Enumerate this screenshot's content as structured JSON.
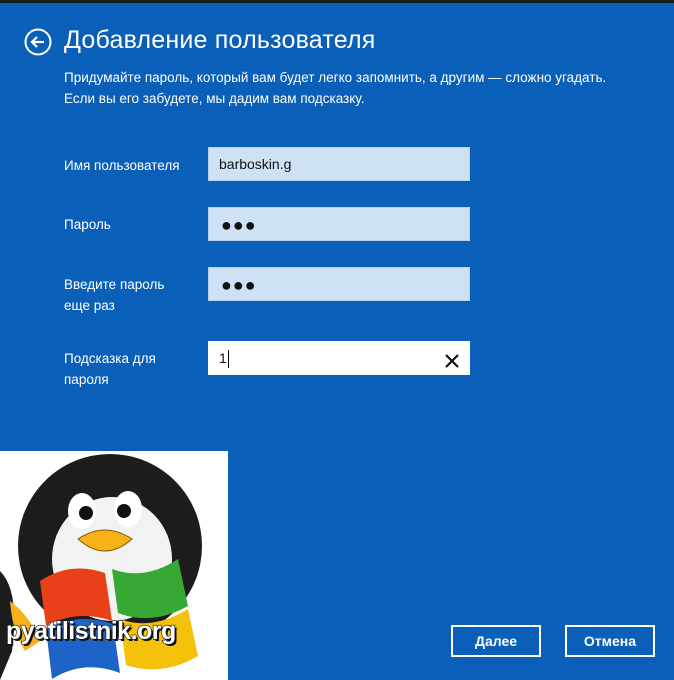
{
  "header": {
    "title": "Добавление пользователя",
    "description": "Придумайте пароль, который вам будет легко запомнить, а другим — сложно угадать. Если вы его забудете, мы дадим вам подсказку."
  },
  "form": {
    "username": {
      "label": "Имя пользователя",
      "value": "barboskin.g"
    },
    "password": {
      "label": "Пароль",
      "value": "●●●"
    },
    "password_confirm": {
      "label_line1": "Введите пароль",
      "label_line2": "еще раз",
      "value": "●●●"
    },
    "hint": {
      "label_line1": "Подсказка для",
      "label_line2": "пароля",
      "value": "1"
    }
  },
  "watermark": {
    "text": "pyatilistnik.org"
  },
  "buttons": {
    "next": "Далее",
    "cancel": "Отмена"
  },
  "colors": {
    "background": "#0a5fb8",
    "field_inactive": "#cfe2f5",
    "field_active": "#ffffff",
    "text": "#ffffff"
  },
  "icons": {
    "back": "back-arrow-circle-icon",
    "clear": "close-icon"
  }
}
